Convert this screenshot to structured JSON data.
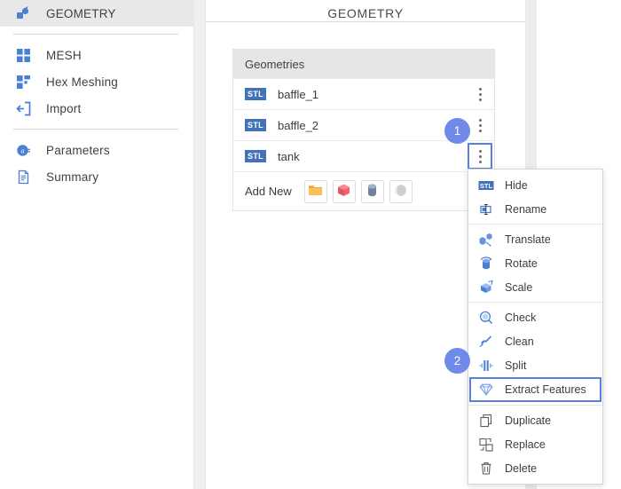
{
  "sidebar": {
    "items": [
      {
        "label": "GEOMETRY",
        "icon": "geometry-icon",
        "active": true,
        "sep_after": true
      },
      {
        "label": "MESH",
        "icon": "mesh-icon",
        "active": false,
        "sep_after": false
      },
      {
        "label": "Hex Meshing",
        "icon": "hex-meshing-icon",
        "active": false,
        "sep_after": false
      },
      {
        "label": "Import",
        "icon": "import-icon",
        "active": false,
        "sep_after": true
      },
      {
        "label": "Parameters",
        "icon": "parameters-icon",
        "active": false,
        "sep_after": false
      },
      {
        "label": "Summary",
        "icon": "summary-icon",
        "active": false,
        "sep_after": false
      }
    ]
  },
  "main": {
    "title": "GEOMETRY",
    "card": {
      "header": "Geometries",
      "rows": [
        {
          "badge": "STL",
          "name": "baffle_1",
          "selected": false
        },
        {
          "badge": "STL",
          "name": "baffle_2",
          "selected": false
        },
        {
          "badge": "STL",
          "name": "tank",
          "selected": true
        }
      ],
      "add_new": {
        "label": "Add New",
        "shapes": [
          {
            "name": "folder-icon",
            "color": "#f0a830"
          },
          {
            "name": "cube-icon",
            "color": "#f2636a"
          },
          {
            "name": "cylinder-icon",
            "color": "#6e829b"
          },
          {
            "name": "sphere-icon",
            "color": "#c6c6c6"
          }
        ]
      }
    }
  },
  "context_menu": {
    "groups": [
      [
        {
          "label": "Hide",
          "icon": "stl-hide-icon"
        },
        {
          "label": "Rename",
          "icon": "rename-icon"
        }
      ],
      [
        {
          "label": "Translate",
          "icon": "translate-icon"
        },
        {
          "label": "Rotate",
          "icon": "rotate-icon"
        },
        {
          "label": "Scale",
          "icon": "scale-icon"
        }
      ],
      [
        {
          "label": "Check",
          "icon": "check-magnifier-icon",
          "highlight": false
        },
        {
          "label": "Clean",
          "icon": "clean-broom-icon",
          "highlight": false
        },
        {
          "label": "Split",
          "icon": "split-icon",
          "highlight": false
        },
        {
          "label": "Extract Features",
          "icon": "diamond-icon",
          "highlight": true
        }
      ],
      [
        {
          "label": "Duplicate",
          "icon": "duplicate-icon"
        },
        {
          "label": "Replace",
          "icon": "replace-icon"
        },
        {
          "label": "Delete",
          "icon": "trash-icon"
        }
      ]
    ]
  },
  "steps": [
    {
      "number": "1"
    },
    {
      "number": "2"
    }
  ],
  "colors": {
    "accent_blue": "#5b7fe0",
    "badge_blue": "#6f8ae8",
    "stl_blue": "#4472b8",
    "icon_blue": "#4a7fd4",
    "sidebar_active": "#e8e8e8",
    "card_header": "#e6e6e6"
  }
}
